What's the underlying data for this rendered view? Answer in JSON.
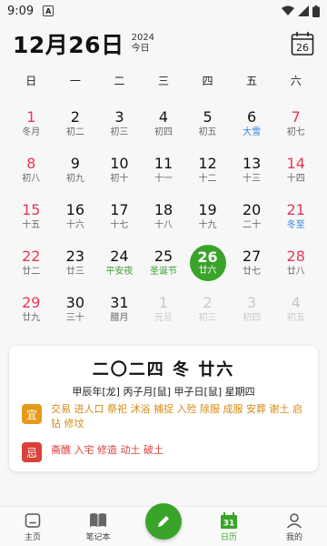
{
  "status": {
    "time": "9:09"
  },
  "header": {
    "date": "12月26日",
    "year": "2024",
    "today": "今日"
  },
  "weekdays": [
    "日",
    "一",
    "二",
    "三",
    "四",
    "五",
    "六"
  ],
  "days": [
    {
      "num": "1",
      "lunar": "冬月"
    },
    {
      "num": "2",
      "lunar": "初二"
    },
    {
      "num": "3",
      "lunar": "初三"
    },
    {
      "num": "4",
      "lunar": "初四"
    },
    {
      "num": "5",
      "lunar": "初五"
    },
    {
      "num": "6",
      "lunar": "大雪"
    },
    {
      "num": "7",
      "lunar": "初七"
    },
    {
      "num": "8",
      "lunar": "初八"
    },
    {
      "num": "9",
      "lunar": "初九"
    },
    {
      "num": "10",
      "lunar": "初十"
    },
    {
      "num": "11",
      "lunar": "十一"
    },
    {
      "num": "12",
      "lunar": "十二"
    },
    {
      "num": "13",
      "lunar": "十三"
    },
    {
      "num": "14",
      "lunar": "十四"
    },
    {
      "num": "15",
      "lunar": "十五"
    },
    {
      "num": "16",
      "lunar": "十六"
    },
    {
      "num": "17",
      "lunar": "十七"
    },
    {
      "num": "18",
      "lunar": "十八"
    },
    {
      "num": "19",
      "lunar": "十九"
    },
    {
      "num": "20",
      "lunar": "二十"
    },
    {
      "num": "21",
      "lunar": "冬至"
    },
    {
      "num": "22",
      "lunar": "廿二"
    },
    {
      "num": "23",
      "lunar": "廿三"
    },
    {
      "num": "24",
      "lunar": "平安夜"
    },
    {
      "num": "25",
      "lunar": "圣诞节"
    },
    {
      "num": "26",
      "lunar": "廿六"
    },
    {
      "num": "27",
      "lunar": "廿七"
    },
    {
      "num": "28",
      "lunar": "廿八"
    },
    {
      "num": "29",
      "lunar": "廿九"
    },
    {
      "num": "30",
      "lunar": "三十"
    },
    {
      "num": "31",
      "lunar": "腊月"
    },
    {
      "num": "1",
      "lunar": "元旦"
    },
    {
      "num": "2",
      "lunar": "初三"
    },
    {
      "num": "3",
      "lunar": "初四"
    },
    {
      "num": "4",
      "lunar": "初五"
    }
  ],
  "card": {
    "title": "二〇二四 冬 廿六",
    "ganzhi": "甲辰年[龙] 丙子月[鼠] 甲子日[鼠] 星期四",
    "yi_label": "宜",
    "yi_items": "交易 进人口 祭祀 沐浴 捕捉 入殓 除服 成服 安葬 谢土 启钻 修坟",
    "ji_label": "忌",
    "ji_items": "斋醮 入宅 修造 动土 破土"
  },
  "nav": {
    "home": "主页",
    "notes": "笔记本",
    "calendar": "日历",
    "calendar_icon_text": "31",
    "mine": "我的"
  },
  "colors": {
    "accent": "#3aa32a",
    "weekend": "#e8365a",
    "term": "#2f7fe8",
    "yi": "#e69a1a",
    "ji": "#d8423a"
  }
}
